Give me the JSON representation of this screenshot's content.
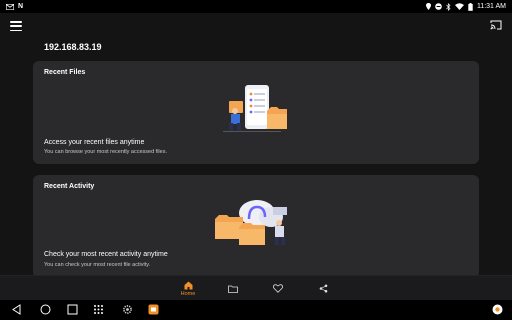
{
  "status_bar": {
    "left_icons": [
      "gmail-icon",
      "n-icon"
    ],
    "right_icons": [
      "location-icon",
      "dnd-icon",
      "bluetooth-icon",
      "wifi-icon",
      "battery-icon"
    ],
    "time": "11:31 AM"
  },
  "header": {
    "ip_address": "192.168.83.19"
  },
  "cards": {
    "recent_files": {
      "title": "Recent Files",
      "heading": "Access your recent files anytime",
      "subtitle": "You can browse your most recently accessed files."
    },
    "recent_activity": {
      "title": "Recent Activity",
      "heading": "Check your most recent activity anytime",
      "subtitle": "You can check your most recent file activity."
    }
  },
  "bottom_nav": {
    "home_label": "Home",
    "items": [
      "home-icon",
      "folder-icon",
      "heart-icon",
      "share-icon"
    ]
  },
  "colors": {
    "accent": "#f0902a",
    "background": "#141414",
    "card": "#2a2a2d"
  }
}
